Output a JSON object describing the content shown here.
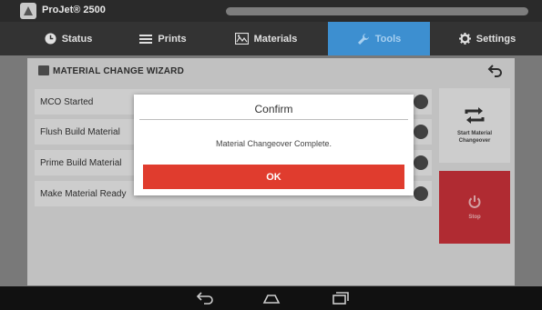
{
  "app": {
    "title": "ProJet® 2500",
    "progress": 0
  },
  "nav": {
    "tabs": [
      {
        "label": "Status",
        "icon": "clock-icon"
      },
      {
        "label": "Prints",
        "icon": "menu-icon"
      },
      {
        "label": "Materials",
        "icon": "materials-icon"
      },
      {
        "label": "Tools",
        "icon": "wrench-icon",
        "active": true
      },
      {
        "label": "Settings",
        "icon": "gear-icon"
      }
    ]
  },
  "wizard": {
    "title": "MATERIAL CHANGE WIZARD",
    "steps": [
      {
        "label": "MCO Started"
      },
      {
        "label": "Flush Build Material"
      },
      {
        "label": "Prime Build Material"
      },
      {
        "label": "Make Material Ready"
      }
    ],
    "start_label": "Start Material Changeover",
    "stop_label": "Stop"
  },
  "dialog": {
    "title": "Confirm",
    "message": "Material Changeover Complete.",
    "ok_label": "OK"
  },
  "colors": {
    "accent": "#3d8fd0",
    "ok": "#e03c2e",
    "stop": "#c9323a"
  }
}
